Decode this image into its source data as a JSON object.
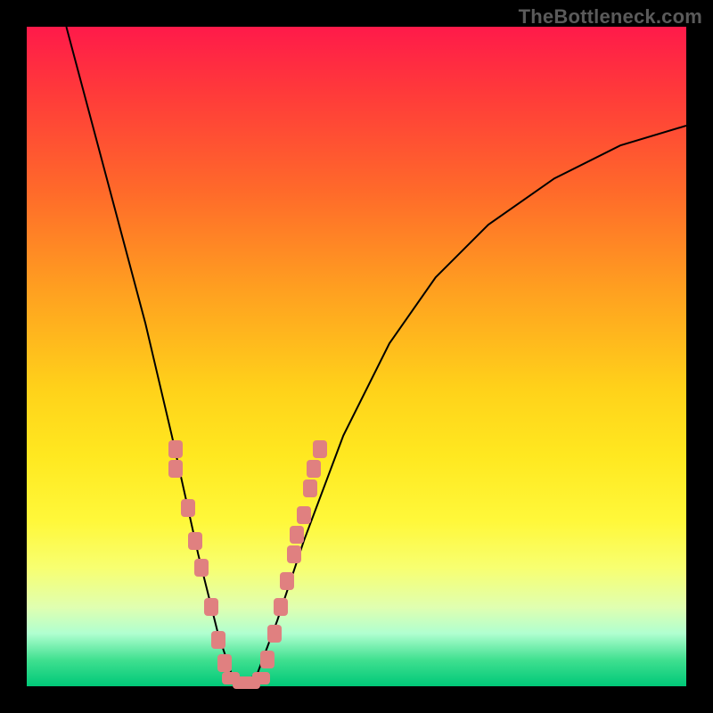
{
  "watermark": "TheBottleneck.com",
  "chart_data": {
    "type": "line",
    "title": "",
    "xlabel": "",
    "ylabel": "",
    "xlim": [
      0,
      100
    ],
    "ylim": [
      0,
      100
    ],
    "curve": {
      "description": "V-shaped bottleneck curve reaching minimum near x≈32 then rising asymptotically",
      "points": [
        {
          "x": 6,
          "y": 100
        },
        {
          "x": 10,
          "y": 85
        },
        {
          "x": 14,
          "y": 70
        },
        {
          "x": 18,
          "y": 55
        },
        {
          "x": 22,
          "y": 38
        },
        {
          "x": 26,
          "y": 20
        },
        {
          "x": 29,
          "y": 8
        },
        {
          "x": 31,
          "y": 2
        },
        {
          "x": 33,
          "y": 0.5
        },
        {
          "x": 35,
          "y": 2
        },
        {
          "x": 38,
          "y": 10
        },
        {
          "x": 42,
          "y": 22
        },
        {
          "x": 48,
          "y": 38
        },
        {
          "x": 55,
          "y": 52
        },
        {
          "x": 62,
          "y": 62
        },
        {
          "x": 70,
          "y": 70
        },
        {
          "x": 80,
          "y": 77
        },
        {
          "x": 90,
          "y": 82
        },
        {
          "x": 100,
          "y": 85
        }
      ]
    },
    "markers_left": [
      {
        "x": 22.5,
        "y": 36
      },
      {
        "x": 22.5,
        "y": 33
      },
      {
        "x": 24.5,
        "y": 27
      },
      {
        "x": 25.5,
        "y": 22
      },
      {
        "x": 26.5,
        "y": 18
      },
      {
        "x": 28.0,
        "y": 12
      },
      {
        "x": 29.0,
        "y": 7
      },
      {
        "x": 30.0,
        "y": 3.5
      }
    ],
    "markers_bottom": [
      {
        "x": 31.0,
        "y": 1.2
      },
      {
        "x": 32.5,
        "y": 0.6
      },
      {
        "x": 34.0,
        "y": 0.6
      },
      {
        "x": 35.5,
        "y": 1.2
      }
    ],
    "markers_right": [
      {
        "x": 36.5,
        "y": 4
      },
      {
        "x": 37.5,
        "y": 8
      },
      {
        "x": 38.5,
        "y": 12
      },
      {
        "x": 39.5,
        "y": 16
      },
      {
        "x": 40.5,
        "y": 20
      },
      {
        "x": 41.0,
        "y": 23
      },
      {
        "x": 42.0,
        "y": 26
      },
      {
        "x": 43.0,
        "y": 30
      },
      {
        "x": 43.5,
        "y": 33
      },
      {
        "x": 44.5,
        "y": 36
      }
    ],
    "marker_color": "#e08080"
  }
}
